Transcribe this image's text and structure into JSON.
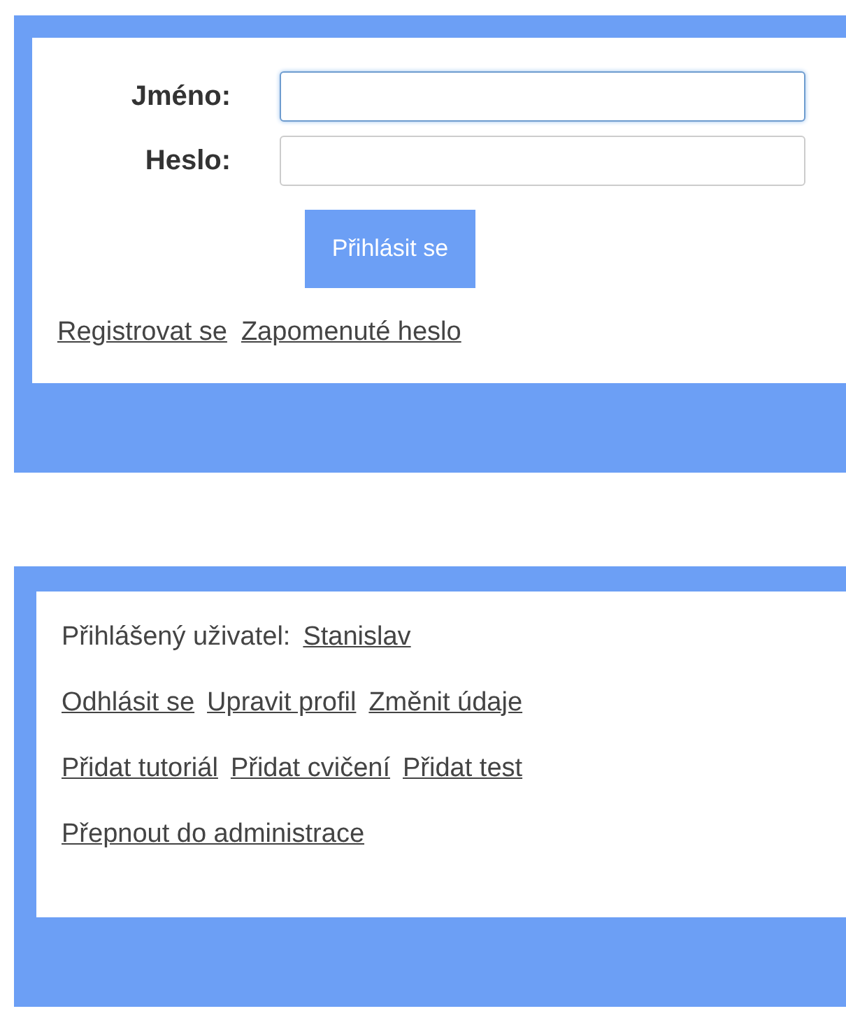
{
  "login": {
    "fields": [
      {
        "label": "Jméno:",
        "focused": true
      },
      {
        "label": "Heslo:",
        "focused": false
      }
    ],
    "submit": "Přihlásit se",
    "links": [
      "Registrovat se",
      "Zapomenuté heslo"
    ]
  },
  "user_panel": {
    "label": "Přihlášený uživatel:",
    "user": "Stanislav",
    "link_rows": [
      [
        "Odhlásit se",
        "Upravit profil",
        "Změnit údaje"
      ],
      [
        "Přidat tutoriál",
        "Přidat cvičení",
        "Přidat test"
      ],
      [
        "Přepnout do administrace"
      ]
    ]
  }
}
